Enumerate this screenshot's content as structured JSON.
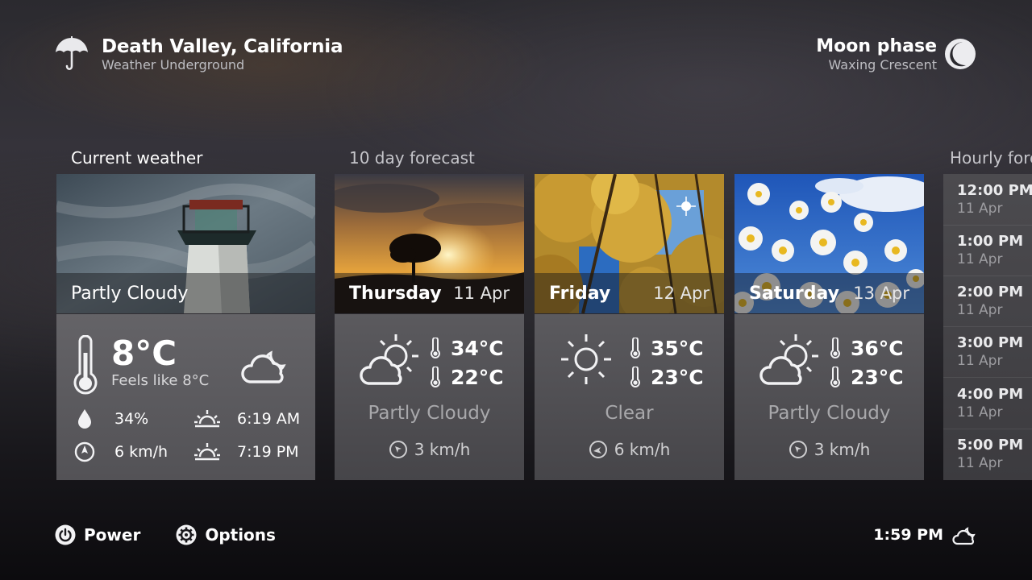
{
  "header": {
    "location": "Death Valley, California",
    "provider": "Weather Underground",
    "moon_title": "Moon phase",
    "moon_phase": "Waxing Crescent"
  },
  "sections": {
    "current": "Current weather",
    "forecast": "10 day forecast",
    "hourly": "Hourly forecast"
  },
  "current": {
    "condition": "Partly Cloudy",
    "temperature": "8°C",
    "feels_like": "Feels like 8°C",
    "humidity": "34%",
    "wind": "6 km/h",
    "sunrise": "6:19 AM",
    "sunset": "7:19 PM",
    "icons": {
      "thermometer": "thermometer-icon",
      "condition": "cloud-moon-icon",
      "humidity": "droplet-icon",
      "wind": "wind-compass-icon",
      "sunrise": "sunrise-icon",
      "sunset": "sunset-icon"
    }
  },
  "forecast": [
    {
      "day": "Thursday",
      "date": "11 Apr",
      "high": "34°C",
      "low": "22°C",
      "condition": "Partly Cloudy",
      "wind": "3 km/h",
      "icon": "partly-cloudy-icon"
    },
    {
      "day": "Friday",
      "date": "12 Apr",
      "high": "35°C",
      "low": "23°C",
      "condition": "Clear",
      "wind": "6 km/h",
      "icon": "sun-icon"
    },
    {
      "day": "Saturday",
      "date": "13 Apr",
      "high": "36°C",
      "low": "23°C",
      "condition": "Partly Cloudy",
      "wind": "3 km/h",
      "icon": "partly-cloudy-icon"
    }
  ],
  "hourly": [
    {
      "time": "12:00 PM",
      "date": "11 Apr"
    },
    {
      "time": "1:00 PM",
      "date": "11 Apr"
    },
    {
      "time": "2:00 PM",
      "date": "11 Apr"
    },
    {
      "time": "3:00 PM",
      "date": "11 Apr"
    },
    {
      "time": "4:00 PM",
      "date": "11 Apr"
    },
    {
      "time": "5:00 PM",
      "date": "11 Apr"
    }
  ],
  "footer": {
    "power": "Power",
    "options": "Options",
    "clock": "1:59 PM"
  },
  "colors": {
    "panel": "#535256",
    "text_muted": "#a8a8ab"
  }
}
